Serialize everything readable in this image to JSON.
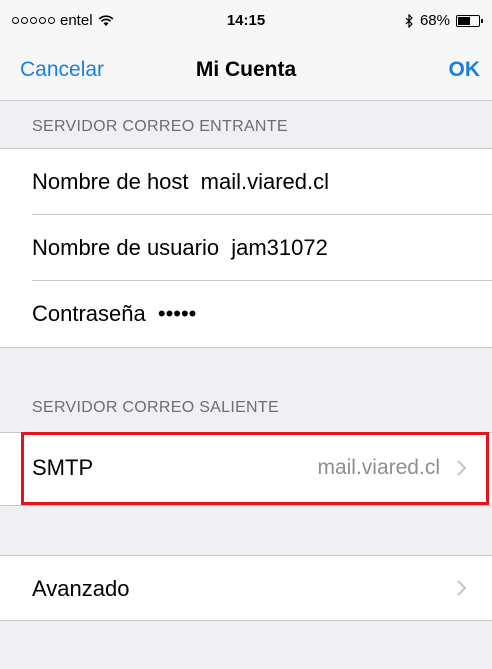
{
  "status_bar": {
    "carrier": "entel",
    "time": "14:15",
    "battery_percent": "68%",
    "battery_level": 0.68
  },
  "nav": {
    "cancel_label": "Cancelar",
    "title": "Mi Cuenta",
    "ok_label": "OK"
  },
  "incoming": {
    "header": "SERVIDOR CORREO ENTRANTE",
    "host_label": "Nombre de host",
    "host_value": "mail.viared.cl",
    "user_label": "Nombre de usuario",
    "user_value": "jam31072",
    "password_label": "Contraseña",
    "password_value": "•••••"
  },
  "outgoing": {
    "header": "SERVIDOR CORREO SALIENTE",
    "smtp_label": "SMTP",
    "smtp_value": "mail.viared.cl"
  },
  "advanced": {
    "label": "Avanzado"
  },
  "colors": {
    "accent": "#1a7fde",
    "highlight": "#e8121b"
  }
}
